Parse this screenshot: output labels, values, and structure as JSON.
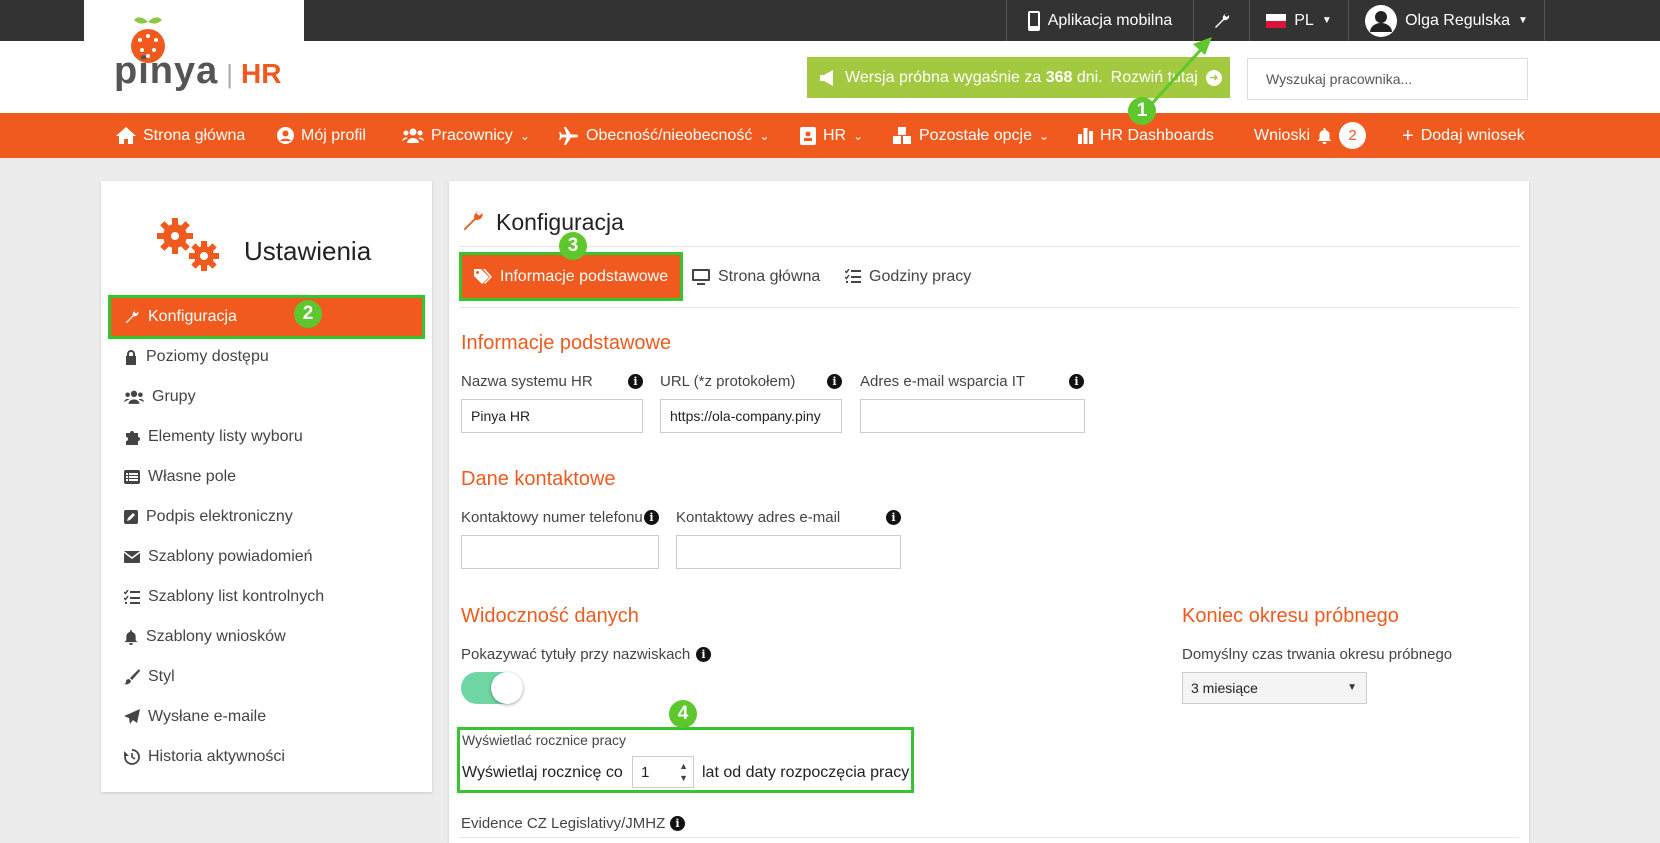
{
  "topbar": {
    "mobile_app": "Aplikacja mobilna",
    "language": "PL",
    "user_name": "Olga Regulska"
  },
  "brand": {
    "logo_text": "pinya",
    "logo_suffix": "HR"
  },
  "trial": {
    "text_before": "Wersja próbna wygaśnie za ",
    "days": "368",
    "text_after": " dni.",
    "link": "Rozwiń tutaj"
  },
  "search": {
    "placeholder": "Wyszukaj pracownika..."
  },
  "nav": {
    "items": [
      {
        "label": "Strona główna",
        "icon": "home-icon"
      },
      {
        "label": "Mój profil",
        "icon": "user-circle-icon"
      },
      {
        "label": "Pracownicy",
        "icon": "users-icon"
      },
      {
        "label": "Obecność/nieobecność",
        "icon": "plane-icon"
      },
      {
        "label": "HR",
        "icon": "id-card-icon"
      },
      {
        "label": "Pozostałe opcje",
        "icon": "cubes-icon"
      },
      {
        "label": "HR Dashboards",
        "icon": "bar-chart-icon"
      }
    ],
    "requests_label": "Wnioski",
    "requests_count": "2",
    "add_request": "Dodaj wniosek"
  },
  "sidebar": {
    "title": "Ustawienia",
    "items": [
      {
        "label": "Konfiguracja",
        "icon": "wrench-icon"
      },
      {
        "label": "Poziomy dostępu",
        "icon": "lock-icon"
      },
      {
        "label": "Grupy",
        "icon": "users-icon"
      },
      {
        "label": "Elementy listy wyboru",
        "icon": "puzzle-icon"
      },
      {
        "label": "Własne pole",
        "icon": "list-icon"
      },
      {
        "label": "Podpis elektroniczny",
        "icon": "signature-icon"
      },
      {
        "label": "Szablony powiadomień",
        "icon": "envelope-icon"
      },
      {
        "label": "Szablony list kontrolnych",
        "icon": "checklist-icon"
      },
      {
        "label": "Szablony wniosków",
        "icon": "bell-icon"
      },
      {
        "label": "Styl",
        "icon": "brush-icon"
      },
      {
        "label": "Wysłane e-maile",
        "icon": "paper-plane-icon"
      },
      {
        "label": "Historia aktywności",
        "icon": "history-icon"
      }
    ]
  },
  "main": {
    "title": "Konfiguracja",
    "tabs": [
      {
        "label": "Informacje podstawowe",
        "icon": "tags-icon"
      },
      {
        "label": "Strona główna",
        "icon": "monitor-icon"
      },
      {
        "label": "Godziny pracy",
        "icon": "checklist-icon"
      }
    ],
    "basic": {
      "heading": "Informacje podstawowe",
      "hr_name_label": "Nazwa systemu HR",
      "hr_name_value": "Pinya HR",
      "url_label": "URL (*z protokołem)",
      "url_value": "https://ola-company.piny",
      "it_email_label": "Adres e-mail wsparcia IT",
      "it_email_value": ""
    },
    "contact": {
      "heading": "Dane kontaktowe",
      "phone_label": "Kontaktowy numer telefonu",
      "email_label": "Kontaktowy adres e-mail"
    },
    "visibility": {
      "heading": "Widoczność danych",
      "titles_label": "Pokazywać tytuły przy nazwiskach",
      "titles_enabled": true,
      "anniv_label": "Wyświetlać rocznice pracy",
      "anniv_prefix": "Wyświetlaj rocznicę co",
      "anniv_value": "1",
      "anniv_suffix": "lat od daty rozpoczęcia pracy",
      "evidence_label": "Evidence CZ Legislativy/JMHZ"
    },
    "probation": {
      "heading": "Koniec okresu próbnego",
      "duration_label": "Domyślny czas trwania okresu próbnego",
      "duration_value": "3 miesiące"
    }
  },
  "annotations": [
    "1",
    "2",
    "3",
    "4"
  ],
  "colors": {
    "accent": "#f05a1e",
    "topbar": "#333333",
    "trial": "#a3c940",
    "annotation": "#5fc72e"
  }
}
